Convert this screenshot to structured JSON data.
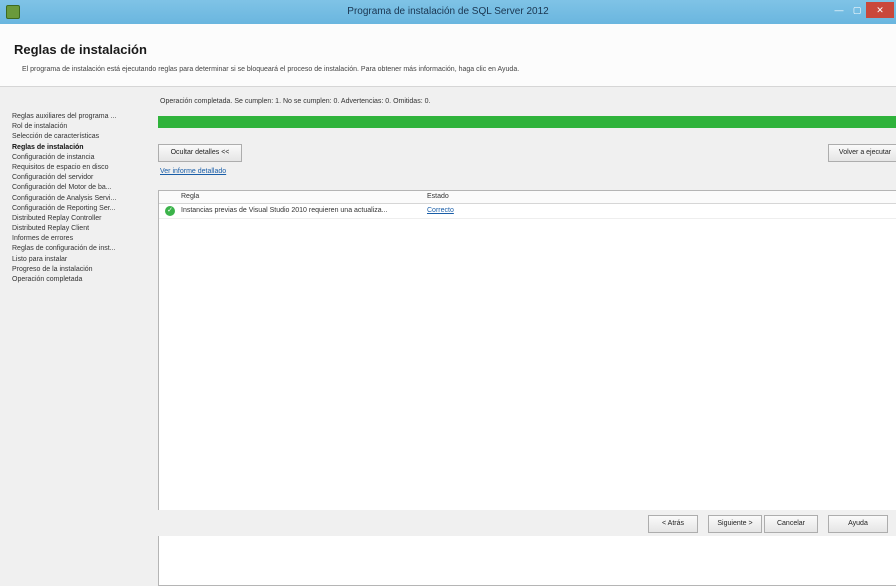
{
  "window": {
    "title": "Programa de instalación de SQL Server 2012",
    "minimize_label": "—",
    "maximize_label": "▢",
    "close_label": "✕"
  },
  "header": {
    "title": "Reglas de instalación",
    "description": "El programa de instalación está ejecutando reglas para determinar si se bloqueará el proceso de instalación. Para obtener más información, haga clic en Ayuda."
  },
  "sidebar": {
    "items": [
      {
        "label": "Reglas auxiliares del programa ...",
        "active": false
      },
      {
        "label": "Rol de instalación",
        "active": false
      },
      {
        "label": "Selección de características",
        "active": false
      },
      {
        "label": "Reglas de instalación",
        "active": true
      },
      {
        "label": "Configuración de instancia",
        "active": false
      },
      {
        "label": "Requisitos de espacio en disco",
        "active": false
      },
      {
        "label": "Configuración del servidor",
        "active": false
      },
      {
        "label": "Configuración del Motor de ba...",
        "active": false
      },
      {
        "label": "Configuración de Analysis Servi...",
        "active": false
      },
      {
        "label": "Configuración de Reporting Ser...",
        "active": false
      },
      {
        "label": "Distributed Replay Controller",
        "active": false
      },
      {
        "label": "Distributed Replay Client",
        "active": false
      },
      {
        "label": "Informes de errores",
        "active": false
      },
      {
        "label": "Reglas de configuración de inst...",
        "active": false
      },
      {
        "label": "Listo para instalar",
        "active": false
      },
      {
        "label": "Progreso de la instalación",
        "active": false
      },
      {
        "label": "Operación completada",
        "active": false
      }
    ]
  },
  "main": {
    "status": "Operación completada. Se cumplen: 1. No se cumplen: 0. Advertencias: 0. Omitidas: 0.",
    "progress_fraction": 1.0,
    "progress_color": "#2fb33b",
    "hide_details_label": "Ocultar detalles <<",
    "rerun_label": "Volver a ejecutar",
    "report_link": "Ver informe detallado",
    "table": {
      "headers": [
        "Regla",
        "Estado"
      ],
      "rows": [
        {
          "icon": "check-icon",
          "rule": "Instancias previas de Visual Studio 2010 requieren una actualiza...",
          "status": "Correcto"
        }
      ]
    }
  },
  "footer": {
    "back_label": "< Atrás",
    "next_label": "Siguiente >",
    "cancel_label": "Cancelar",
    "help_label": "Ayuda"
  }
}
